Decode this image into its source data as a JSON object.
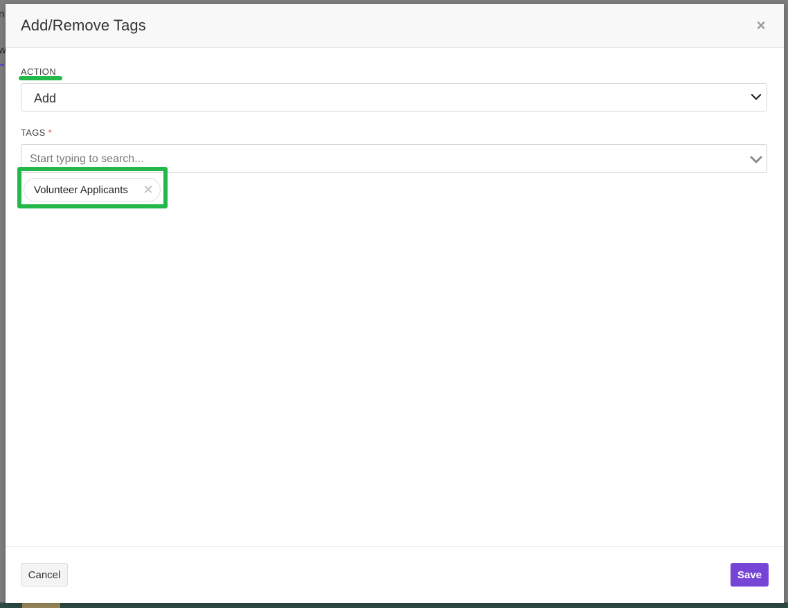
{
  "background": {
    "text_fragment_1": "n",
    "text_fragment_2": "w"
  },
  "modal": {
    "title": "Add/Remove Tags",
    "close_icon": "close-icon",
    "close_glyph": "×"
  },
  "action": {
    "label": "ACTION",
    "selected_value": "Add",
    "icon": "chevron-down-icon"
  },
  "tags": {
    "label": "TAGS",
    "required_marker": "*",
    "search_placeholder": "Start typing to search...",
    "search_value": "",
    "icon": "chevron-down-icon",
    "selected": [
      {
        "label": "Volunteer Applicants",
        "remove_glyph": "✕"
      }
    ]
  },
  "footer": {
    "cancel_label": "Cancel",
    "save_label": "Save"
  },
  "colors": {
    "accent": "#7645d6",
    "highlight": "#22b84a",
    "required": "#d9534f"
  }
}
